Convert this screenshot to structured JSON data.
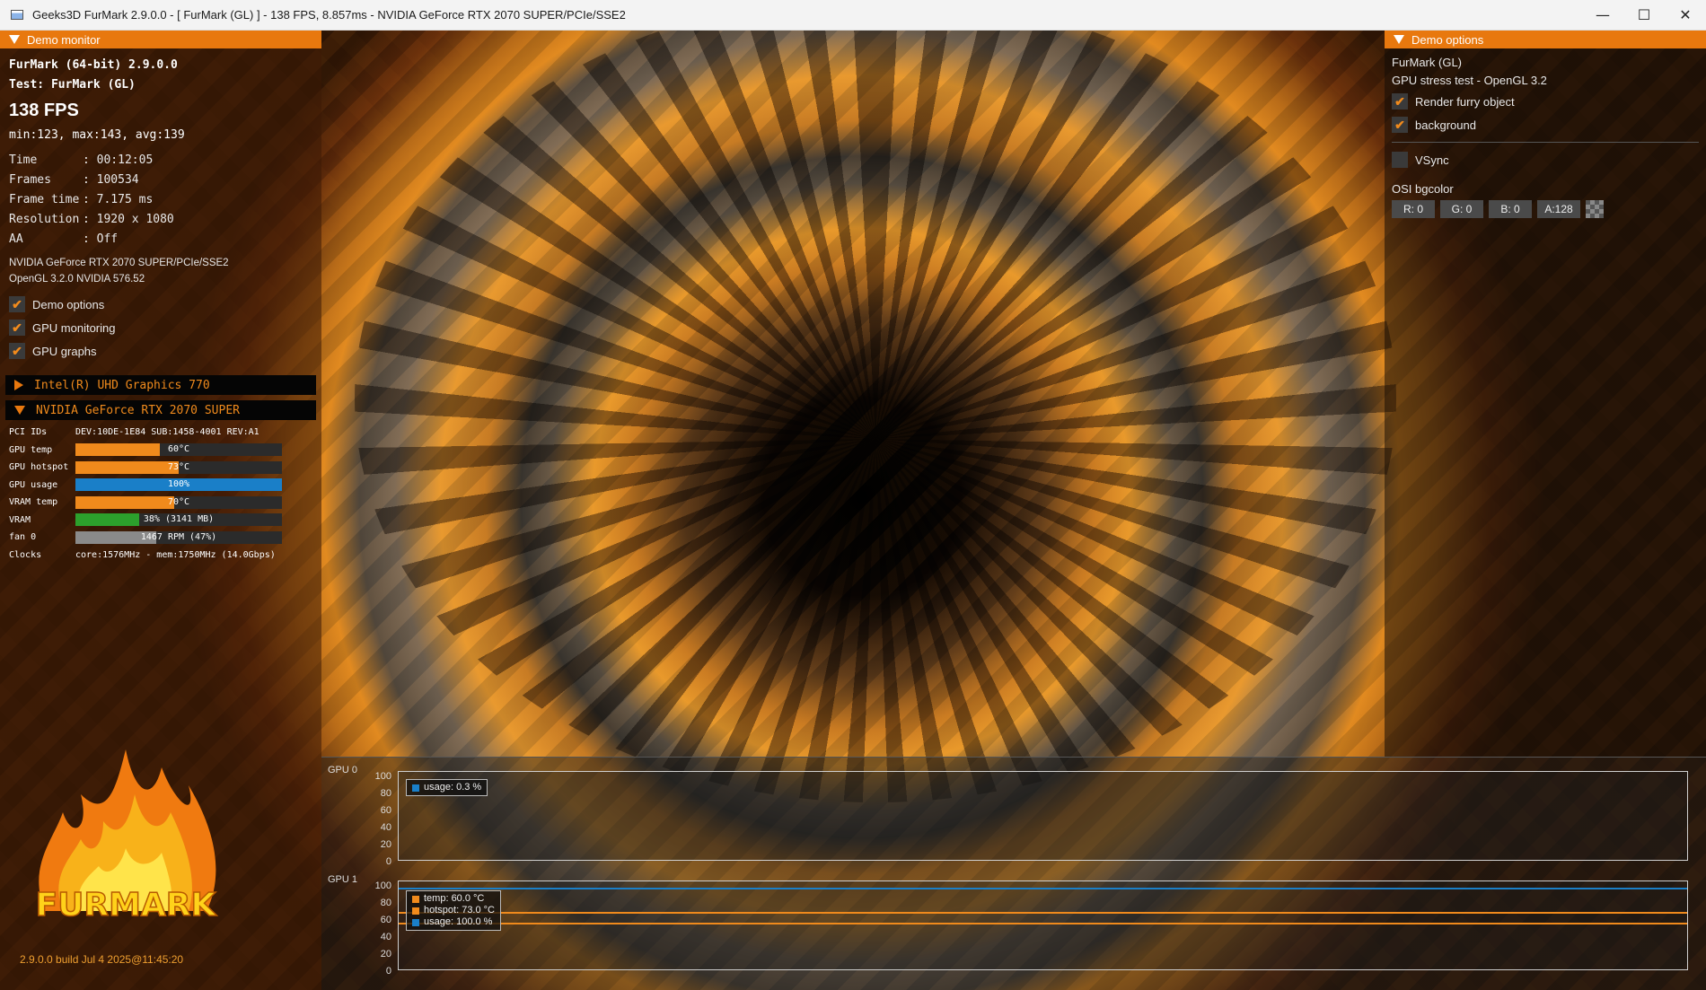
{
  "window": {
    "title": "Geeks3D FurMark 2.9.0.0 - [ FurMark (GL) ] - 138 FPS, 8.857ms - NVIDIA GeForce RTX 2070 SUPER/PCIe/SSE2",
    "minimize": "—",
    "maximize": "☐",
    "close": "✕"
  },
  "left_panel": {
    "header": "Demo monitor",
    "app_line": "FurMark (64-bit) 2.9.0.0",
    "test_line": "Test: FurMark (GL)",
    "fps": "138 FPS",
    "minmax": "min:123, max:143, avg:139",
    "info": [
      {
        "key": "Time",
        "value": ": 00:12:05"
      },
      {
        "key": "Frames",
        "value": ": 100534"
      },
      {
        "key": "Frame time",
        "value": ": 7.175 ms"
      },
      {
        "key": "Resolution",
        "value": ": 1920 x 1080"
      },
      {
        "key": "AA",
        "value": ": Off"
      }
    ],
    "renderer": "NVIDIA GeForce RTX 2070 SUPER/PCIe/SSE2",
    "opengl": "OpenGL 3.2.0 NVIDIA 576.52",
    "checks": [
      {
        "label": "Demo options",
        "checked": true
      },
      {
        "label": "GPU monitoring",
        "checked": true
      },
      {
        "label": "GPU graphs",
        "checked": true
      }
    ],
    "gpu_collapsed": "Intel(R) UHD Graphics 770",
    "gpu_expanded": "NVIDIA GeForce RTX 2070 SUPER",
    "pci_label": "PCI IDs",
    "pci_value": "DEV:10DE-1E84 SUB:1458-4001 REV:A1",
    "stats": [
      {
        "label": "GPU temp",
        "text": "60°C",
        "fraction": 0.41,
        "color": "#f08a1c"
      },
      {
        "label": "GPU hotspot",
        "text": "73°C",
        "fraction": 0.5,
        "color": "#f08a1c"
      },
      {
        "label": "GPU usage",
        "text": "100%",
        "fraction": 1.0,
        "color": "#1a7fc8"
      },
      {
        "label": "VRAM temp",
        "text": "70°C",
        "fraction": 0.48,
        "color": "#f08a1c"
      },
      {
        "label": "VRAM",
        "text": "38% (3141 MB)",
        "fraction": 0.31,
        "color": "#2ca02c"
      },
      {
        "label": "fan 0",
        "text": "1467 RPM (47%)",
        "fraction": 0.39,
        "color": "#8a8a8a"
      }
    ],
    "clocks_label": "Clocks",
    "clocks_value": "core:1576MHz - mem:1750MHz (14.0Gbps)",
    "logo_text": "FURMARK",
    "build": "2.9.0.0 build Jul  4 2025@11:45:20"
  },
  "right_panel": {
    "header": "Demo options",
    "name": "FurMark (GL)",
    "desc": "GPU stress test - OpenGL 3.2",
    "checks": [
      {
        "label": "Render furry object",
        "checked": true
      },
      {
        "label": "background",
        "checked": true
      }
    ],
    "vsync": "VSync",
    "osi_label": "OSI bgcolor",
    "r": "R: 0",
    "g": "G: 0",
    "b": "B: 0",
    "a": "A:128"
  },
  "graphs": {
    "gpu0": {
      "label": "GPU 0",
      "yticks": [
        "100",
        "80",
        "60",
        "40",
        "20",
        "0"
      ],
      "legend": [
        {
          "text": "usage: 0.3 %",
          "color": "#1a7fc8"
        }
      ]
    },
    "gpu1": {
      "label": "GPU 1",
      "yticks": [
        "100",
        "80",
        "60",
        "40",
        "20",
        "0"
      ],
      "legend": [
        {
          "text": "temp: 60.0 °C",
          "color": "#f08a1c"
        },
        {
          "text": "hotspot: 73.0 °C",
          "color": "#f08a1c"
        },
        {
          "text": "usage: 100.0 %",
          "color": "#1a7fc8"
        }
      ]
    }
  }
}
